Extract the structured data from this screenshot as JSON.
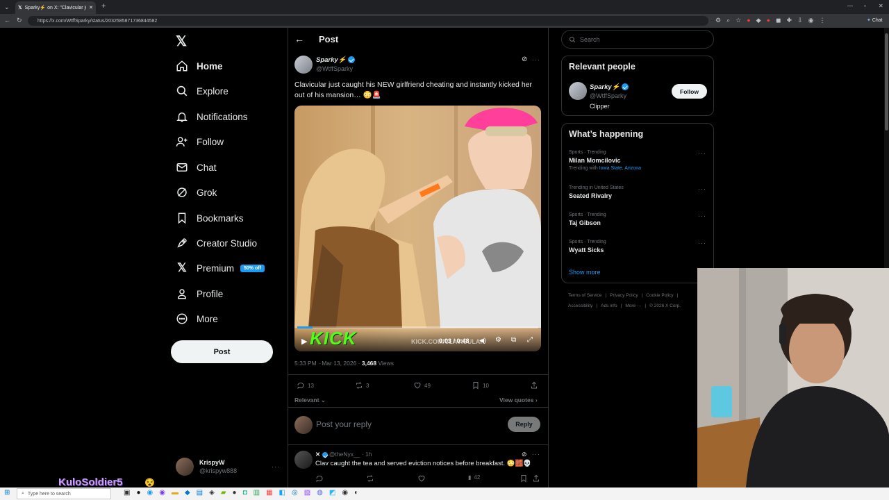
{
  "browser": {
    "tab_title": "Sparky⚡ on X: \"Clavicular just ca…",
    "url": "https://x.com/WtffSparky/status/2032585871736844582",
    "right_chrome_label": "Chat"
  },
  "nav": {
    "items": [
      {
        "label": "Home",
        "icon": "home-icon"
      },
      {
        "label": "Explore",
        "icon": "search-icon"
      },
      {
        "label": "Notifications",
        "icon": "bell-icon"
      },
      {
        "label": "Follow",
        "icon": "person-add-icon"
      },
      {
        "label": "Chat",
        "icon": "mail-icon"
      },
      {
        "label": "Grok",
        "icon": "grok-icon"
      },
      {
        "label": "Bookmarks",
        "icon": "bookmark-icon"
      },
      {
        "label": "Creator Studio",
        "icon": "rocket-icon"
      },
      {
        "label": "Premium",
        "icon": "x-logo-icon"
      },
      {
        "label": "Profile",
        "icon": "person-icon"
      },
      {
        "label": "More",
        "icon": "more-circle-icon"
      }
    ],
    "premium_badge": "50% off",
    "post_button": "Post",
    "account": {
      "name": "KrispyW",
      "handle": "@krispyw888"
    }
  },
  "overlay": {
    "name": "KuloSoldier5"
  },
  "header": {
    "title": "Post"
  },
  "tweet": {
    "author_name": "Sparky⚡",
    "author_handle": "@WtffSparky",
    "text": "Clavicular just caught his NEW girlfriend cheating and instantly kicked her out of his mansion… 😳🚨",
    "video": {
      "time": "0:03 / 0:48",
      "watermark": "KICK.COM/CLAVICULAR",
      "brand": "KICK",
      "progress": 0.0625
    },
    "timestamp": "5:33 PM · Mar 13, 2026 · ",
    "views_count": "3,468",
    "views_label": " Views",
    "replies": "13",
    "reposts": "3",
    "likes": "49",
    "bookmarks": "10",
    "sort_label": "Relevant",
    "view_quotes": "View quotes"
  },
  "reply_box": {
    "placeholder": "Post your reply",
    "button": "Reply"
  },
  "reply": {
    "name": "✕",
    "handle": "@theNyx__",
    "time": "· 1h",
    "text": "Clav caught the tea and served eviction notices before breakfast. 😳🧱💀",
    "views": "42"
  },
  "search": {
    "placeholder": "Search"
  },
  "relevant_people": {
    "title": "Relevant people",
    "name": "Sparky⚡",
    "handle": "@WtffSparky",
    "bio": "Clipper",
    "follow": "Follow"
  },
  "happening": {
    "title": "What’s happening",
    "trends": [
      {
        "category": "Sports · Trending",
        "name": "Milan Momcilovic",
        "extra_prefix": "Trending with ",
        "extra_links": "Iowa State, Arizona"
      },
      {
        "category": "Trending in United States",
        "name": "Seated Rivalry"
      },
      {
        "category": "Sports · Trending",
        "name": "Taj Gibson"
      },
      {
        "category": "Sports · Trending",
        "name": "Wyatt Sicks"
      }
    ],
    "show_more": "Show more"
  },
  "footer": {
    "line1": [
      "Terms of Service",
      "Privacy Policy",
      "Cookie Policy"
    ],
    "line2": [
      "Accessibility",
      "Ads info",
      "More ···",
      "© 2026 X Corp."
    ]
  },
  "taskbar": {
    "search_placeholder": "Type here to search"
  },
  "colors": {
    "accent": "#1d9bf0",
    "kick_green": "#53fc18",
    "background": "#000000",
    "border": "#2f3336"
  }
}
